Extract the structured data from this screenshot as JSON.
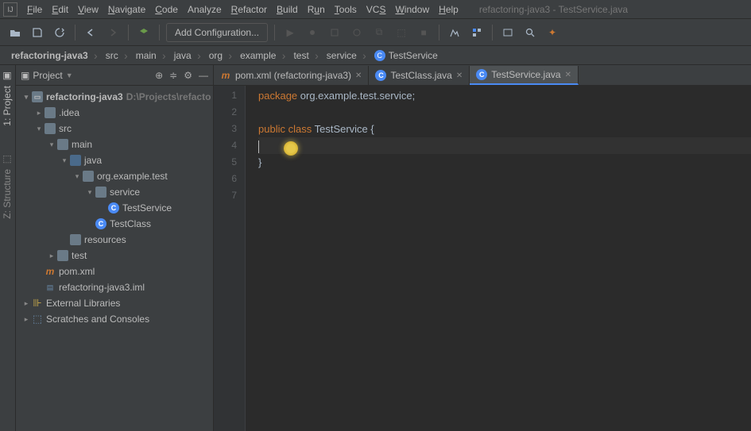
{
  "window_title": "refactoring-java3 - TestService.java",
  "menu": {
    "file": "File",
    "edit": "Edit",
    "view": "View",
    "navigate": "Navigate",
    "code": "Code",
    "analyze": "Analyze",
    "refactor": "Refactor",
    "build": "Build",
    "run": "Run",
    "tools": "Tools",
    "vcs": "VCS",
    "window": "Window",
    "help": "Help"
  },
  "toolbar": {
    "add_configuration": "Add Configuration..."
  },
  "breadcrumb": [
    "refactoring-java3",
    "src",
    "main",
    "java",
    "org",
    "example",
    "test",
    "service",
    "TestService"
  ],
  "sidebar": {
    "header_label": "Project",
    "root": {
      "name": "refactoring-java3",
      "path": "D:\\Projects\\refacto"
    },
    "idea": ".idea",
    "src": "src",
    "main": "main",
    "java": "java",
    "pkg": "org.example.test",
    "service_pkg": "service",
    "test_service": "TestService",
    "test_class": "TestClass",
    "resources": "resources",
    "test": "test",
    "pom": "pom.xml",
    "iml": "refactoring-java3.iml",
    "ext_lib": "External Libraries",
    "scratches": "Scratches and Consoles"
  },
  "edge": {
    "project": "1: Project",
    "structure": "Z: Structure"
  },
  "tabs": [
    {
      "label": "pom.xml (refactoring-java3)",
      "type": "m"
    },
    {
      "label": "TestClass.java",
      "type": "c"
    },
    {
      "label": "TestService.java",
      "type": "c",
      "active": true
    }
  ],
  "gutter": [
    "1",
    "2",
    "3",
    "4",
    "5",
    "6",
    "7"
  ],
  "code": {
    "l1_kw": "package",
    "l1_rest": " org.example.test.service;",
    "l3_kw1": "public",
    "l3_kw2": "class",
    "l3_cls": " TestService ",
    "l3_brace": "{",
    "l5_brace": "}"
  }
}
